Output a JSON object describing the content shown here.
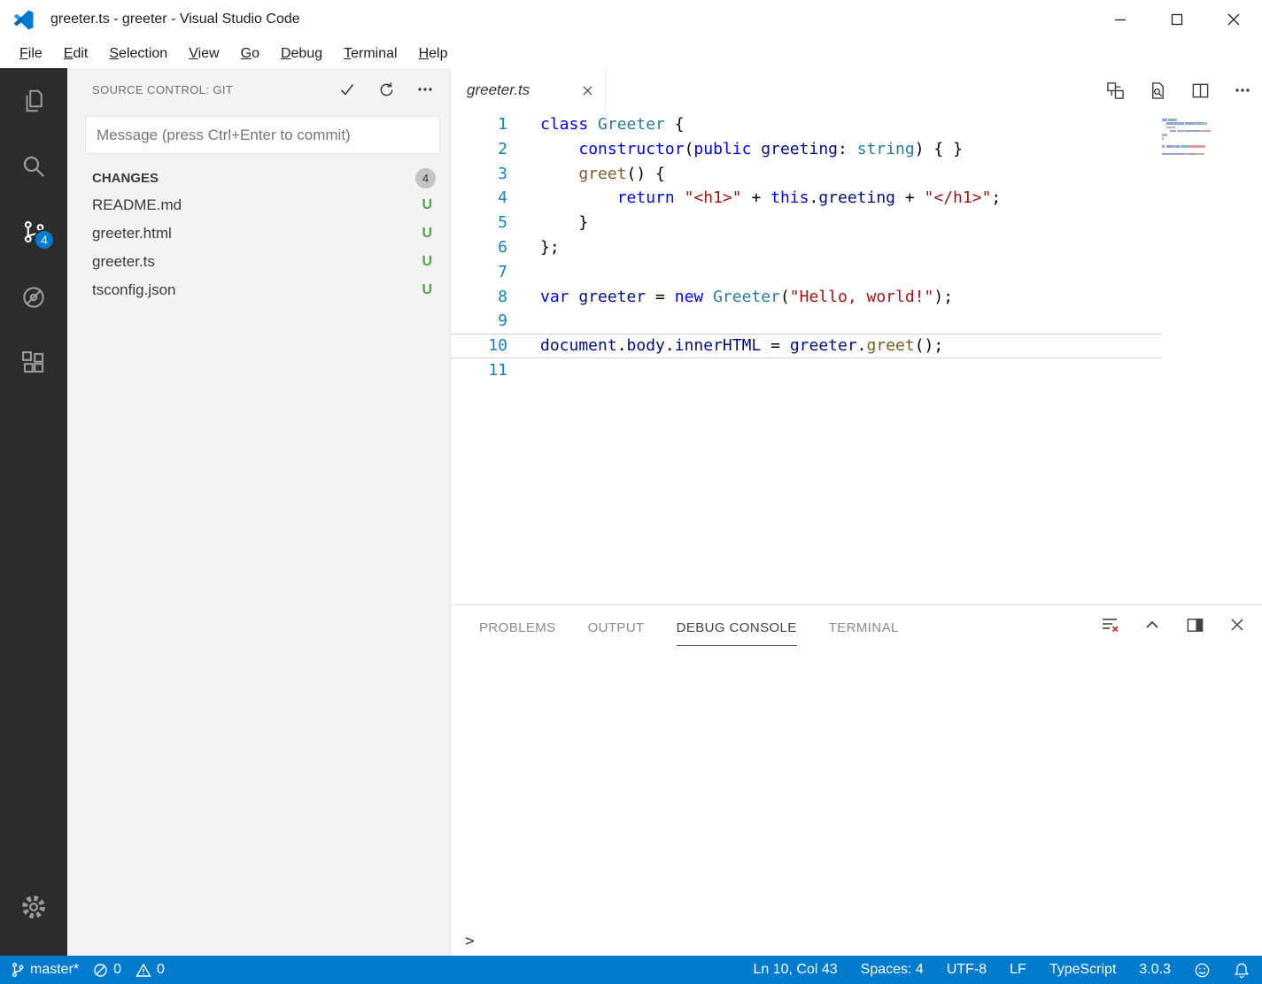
{
  "window": {
    "title": "greeter.ts - greeter - Visual Studio Code"
  },
  "menu": {
    "items": [
      "File",
      "Edit",
      "Selection",
      "View",
      "Go",
      "Debug",
      "Terminal",
      "Help"
    ]
  },
  "activity_bar": {
    "source_control_badge": "4"
  },
  "sidebar": {
    "header": "SOURCE CONTROL: GIT",
    "commit_input_placeholder": "Message (press Ctrl+Enter to commit)",
    "changes": {
      "label": "CHANGES",
      "count": "4"
    },
    "files": [
      {
        "name": "README.md",
        "status": "U"
      },
      {
        "name": "greeter.html",
        "status": "U"
      },
      {
        "name": "greeter.ts",
        "status": "U"
      },
      {
        "name": "tsconfig.json",
        "status": "U"
      }
    ]
  },
  "editor": {
    "tabs": [
      {
        "label": "greeter.ts",
        "active": true
      }
    ],
    "current_line": 10,
    "lines": [
      {
        "n": 1,
        "tokens": [
          [
            "kw",
            "class"
          ],
          [
            "plain",
            " "
          ],
          [
            "type",
            "Greeter"
          ],
          [
            "plain",
            " {"
          ]
        ]
      },
      {
        "n": 2,
        "tokens": [
          [
            "plain",
            "    "
          ],
          [
            "kw",
            "constructor"
          ],
          [
            "plain",
            "("
          ],
          [
            "kw",
            "public"
          ],
          [
            "plain",
            " "
          ],
          [
            "ident",
            "greeting"
          ],
          [
            "plain",
            ": "
          ],
          [
            "type",
            "string"
          ],
          [
            "plain",
            ") { }"
          ]
        ]
      },
      {
        "n": 3,
        "tokens": [
          [
            "plain",
            "    "
          ],
          [
            "fn",
            "greet"
          ],
          [
            "plain",
            "() {"
          ]
        ]
      },
      {
        "n": 4,
        "tokens": [
          [
            "plain",
            "        "
          ],
          [
            "kw",
            "return"
          ],
          [
            "plain",
            " "
          ],
          [
            "str",
            "\"<h1>\""
          ],
          [
            "plain",
            " + "
          ],
          [
            "kw",
            "this"
          ],
          [
            "plain",
            "."
          ],
          [
            "ident",
            "greeting"
          ],
          [
            "plain",
            " + "
          ],
          [
            "str",
            "\"</h1>\""
          ],
          [
            "plain",
            ";"
          ]
        ]
      },
      {
        "n": 5,
        "tokens": [
          [
            "plain",
            "    }"
          ]
        ]
      },
      {
        "n": 6,
        "tokens": [
          [
            "plain",
            "};"
          ]
        ]
      },
      {
        "n": 7,
        "tokens": []
      },
      {
        "n": 8,
        "tokens": [
          [
            "kw",
            "var"
          ],
          [
            "plain",
            " "
          ],
          [
            "ident",
            "greeter"
          ],
          [
            "plain",
            " = "
          ],
          [
            "kw",
            "new"
          ],
          [
            "plain",
            " "
          ],
          [
            "type",
            "Greeter"
          ],
          [
            "plain",
            "("
          ],
          [
            "str",
            "\"Hello, world!\""
          ],
          [
            "plain",
            ");"
          ]
        ]
      },
      {
        "n": 9,
        "tokens": []
      },
      {
        "n": 10,
        "tokens": [
          [
            "ident",
            "document"
          ],
          [
            "plain",
            "."
          ],
          [
            "ident",
            "body"
          ],
          [
            "plain",
            "."
          ],
          [
            "ident",
            "innerHTML"
          ],
          [
            "plain",
            " = "
          ],
          [
            "ident",
            "greeter"
          ],
          [
            "plain",
            "."
          ],
          [
            "fn",
            "greet"
          ],
          [
            "plain",
            "();"
          ]
        ]
      },
      {
        "n": 11,
        "tokens": []
      }
    ]
  },
  "panel": {
    "tabs": [
      {
        "label": "PROBLEMS",
        "active": false
      },
      {
        "label": "OUTPUT",
        "active": false
      },
      {
        "label": "DEBUG CONSOLE",
        "active": true
      },
      {
        "label": "TERMINAL",
        "active": false
      }
    ],
    "input_prompt": ">"
  },
  "status_bar": {
    "branch": "master*",
    "errors": "0",
    "warnings": "0",
    "right_items": [
      {
        "name": "cursor-position",
        "label": "Ln 10, Col 43"
      },
      {
        "name": "indentation",
        "label": "Spaces: 4"
      },
      {
        "name": "encoding",
        "label": "UTF-8"
      },
      {
        "name": "eol",
        "label": "LF"
      },
      {
        "name": "language-mode",
        "label": "TypeScript"
      },
      {
        "name": "ts-version",
        "label": "3.0.3"
      }
    ]
  },
  "colors": {
    "accent": "#007acc",
    "activity_bar_bg": "#2c2c2c",
    "untracked_green": "#55a349",
    "badge_bg": "#c4c4c4",
    "keyword": "#0000ff",
    "type": "#267f99",
    "string": "#a31515",
    "identifier": "#001080",
    "function": "#795e26",
    "line_number": "#1583b3"
  }
}
